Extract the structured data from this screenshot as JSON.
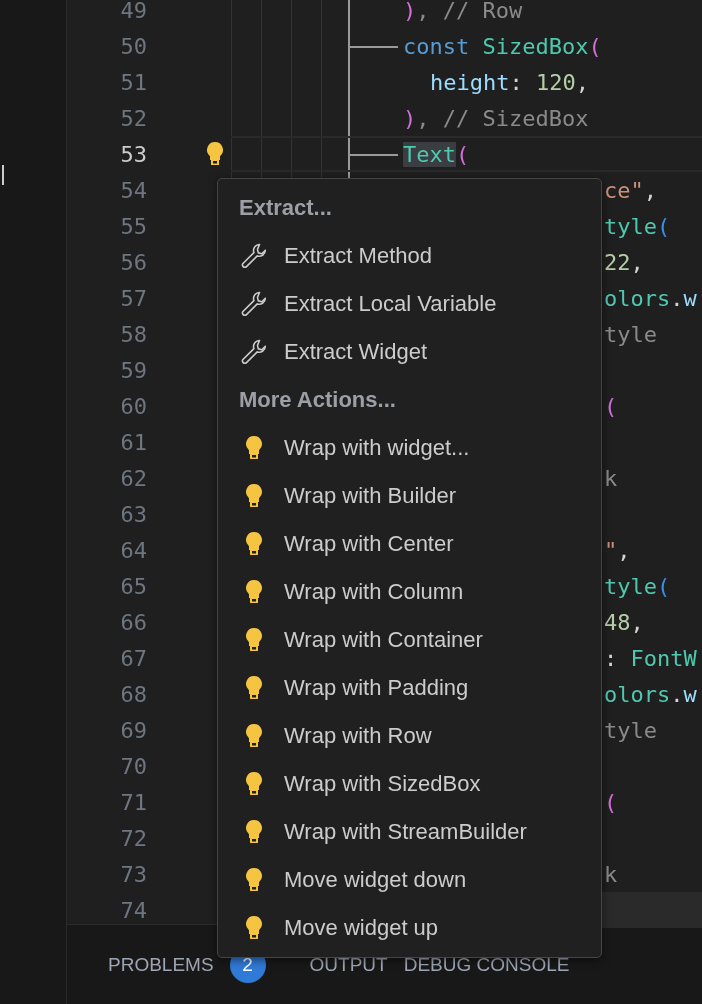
{
  "editor": {
    "lines": [
      {
        "number": "49",
        "kind": "code",
        "current": false,
        "highlighted": false,
        "branch": false,
        "tokens": [
          {
            "text": ")",
            "kind": "paren"
          },
          {
            "text": ", // Row",
            "kind": "comment"
          }
        ]
      },
      {
        "number": "50",
        "kind": "code",
        "current": false,
        "highlighted": false,
        "branch": true,
        "tokens": [
          {
            "text": "const ",
            "kind": "keyword"
          },
          {
            "text": "SizedBox",
            "kind": "type"
          },
          {
            "text": "(",
            "kind": "paren"
          }
        ]
      },
      {
        "number": "51",
        "kind": "nested",
        "current": false,
        "highlighted": false,
        "branch": false,
        "tokens": [
          {
            "text": "height",
            "kind": "prop"
          },
          {
            "text": ": ",
            "kind": "punct"
          },
          {
            "text": "120",
            "kind": "number"
          },
          {
            "text": ",",
            "kind": "punct"
          }
        ]
      },
      {
        "number": "52",
        "kind": "code",
        "current": false,
        "highlighted": false,
        "branch": false,
        "tokens": [
          {
            "text": ")",
            "kind": "paren"
          },
          {
            "text": ", // SizedBox",
            "kind": "comment"
          }
        ]
      },
      {
        "number": "53",
        "kind": "code",
        "current": true,
        "highlighted": false,
        "branch": true,
        "tokens": [
          {
            "text": "Text",
            "kind": "type"
          },
          {
            "text": "(",
            "kind": "paren"
          }
        ]
      },
      {
        "number": "54",
        "kind": "fragment",
        "current": false,
        "tokens": [
          {
            "text": "ce\"",
            "kind": "string"
          },
          {
            "text": ",",
            "kind": "punct"
          }
        ]
      },
      {
        "number": "55",
        "kind": "fragment",
        "current": false,
        "tokens": [
          {
            "text": "tyle",
            "kind": "type"
          },
          {
            "text": "(",
            "kind": "paren2"
          }
        ]
      },
      {
        "number": "56",
        "kind": "fragment",
        "current": false,
        "tokens": [
          {
            "text": "22",
            "kind": "number"
          },
          {
            "text": ",",
            "kind": "punct"
          }
        ]
      },
      {
        "number": "57",
        "kind": "fragment",
        "current": false,
        "tokens": [
          {
            "text": "olors",
            "kind": "type"
          },
          {
            "text": ".",
            "kind": "punct"
          },
          {
            "text": "w",
            "kind": "prop"
          }
        ]
      },
      {
        "number": "58",
        "kind": "fragment",
        "current": false,
        "tokens": [
          {
            "text": "tyle",
            "kind": "comment"
          }
        ]
      },
      {
        "number": "59",
        "kind": "fragment",
        "current": false
      },
      {
        "number": "60",
        "kind": "fragment",
        "current": false,
        "tokens": [
          {
            "text": "(",
            "kind": "paren"
          }
        ]
      },
      {
        "number": "61",
        "kind": "fragment",
        "current": false
      },
      {
        "number": "62",
        "kind": "fragment",
        "current": false,
        "tokens": [
          {
            "text": "k",
            "kind": "comment"
          }
        ]
      },
      {
        "number": "63",
        "kind": "fragment",
        "current": false
      },
      {
        "number": "64",
        "kind": "fragment",
        "current": false,
        "tokens": [
          {
            "text": "\"",
            "kind": "string"
          },
          {
            "text": ",",
            "kind": "punct"
          }
        ]
      },
      {
        "number": "65",
        "kind": "fragment",
        "current": false,
        "tokens": [
          {
            "text": "tyle",
            "kind": "type"
          },
          {
            "text": "(",
            "kind": "paren2"
          }
        ]
      },
      {
        "number": "66",
        "kind": "fragment",
        "current": false,
        "tokens": [
          {
            "text": "48",
            "kind": "number"
          },
          {
            "text": ",",
            "kind": "punct"
          }
        ]
      },
      {
        "number": "67",
        "kind": "fragment",
        "current": false,
        "tokens": [
          {
            "text": ": ",
            "kind": "punct"
          },
          {
            "text": "FontW",
            "kind": "type"
          }
        ]
      },
      {
        "number": "68",
        "kind": "fragment",
        "current": false,
        "tokens": [
          {
            "text": "olors",
            "kind": "type"
          },
          {
            "text": ".",
            "kind": "punct"
          },
          {
            "text": "w",
            "kind": "prop"
          }
        ]
      },
      {
        "number": "69",
        "kind": "fragment",
        "current": false,
        "tokens": [
          {
            "text": "tyle",
            "kind": "comment"
          }
        ]
      },
      {
        "number": "70",
        "kind": "fragment",
        "current": false
      },
      {
        "number": "71",
        "kind": "fragment",
        "current": false,
        "tokens": [
          {
            "text": "(",
            "kind": "paren"
          }
        ]
      },
      {
        "number": "72",
        "kind": "fragment",
        "current": false
      },
      {
        "number": "73",
        "kind": "fragment",
        "current": false,
        "tokens": [
          {
            "text": "k",
            "kind": "comment"
          }
        ]
      },
      {
        "number": "74",
        "kind": "fragment",
        "current": false,
        "highlighted": true
      }
    ]
  },
  "context_menu": {
    "sections": [
      {
        "title": "Extract...",
        "items": [
          {
            "label": "Extract Method",
            "kind": "wrench"
          },
          {
            "label": "Extract Local Variable",
            "kind": "wrench"
          },
          {
            "label": "Extract Widget",
            "kind": "wrench"
          }
        ]
      },
      {
        "title": "More Actions...",
        "items": [
          {
            "label": "Wrap with widget...",
            "kind": "bulb"
          },
          {
            "label": "Wrap with Builder",
            "kind": "bulb"
          },
          {
            "label": "Wrap with Center",
            "kind": "bulb"
          },
          {
            "label": "Wrap with Column",
            "kind": "bulb"
          },
          {
            "label": "Wrap with Container",
            "kind": "bulb"
          },
          {
            "label": "Wrap with Padding",
            "kind": "bulb"
          },
          {
            "label": "Wrap with Row",
            "kind": "bulb"
          },
          {
            "label": "Wrap with SizedBox",
            "kind": "bulb"
          },
          {
            "label": "Wrap with StreamBuilder",
            "kind": "bulb"
          },
          {
            "label": "Move widget down",
            "kind": "bulb"
          },
          {
            "label": "Move widget up",
            "kind": "bulb"
          }
        ]
      }
    ]
  },
  "panel": {
    "tabs": [
      {
        "label": "PROBLEMS",
        "badge": "2"
      },
      {
        "label": "OUTPUT"
      },
      {
        "label": "DEBUG CONSOLE"
      }
    ]
  }
}
